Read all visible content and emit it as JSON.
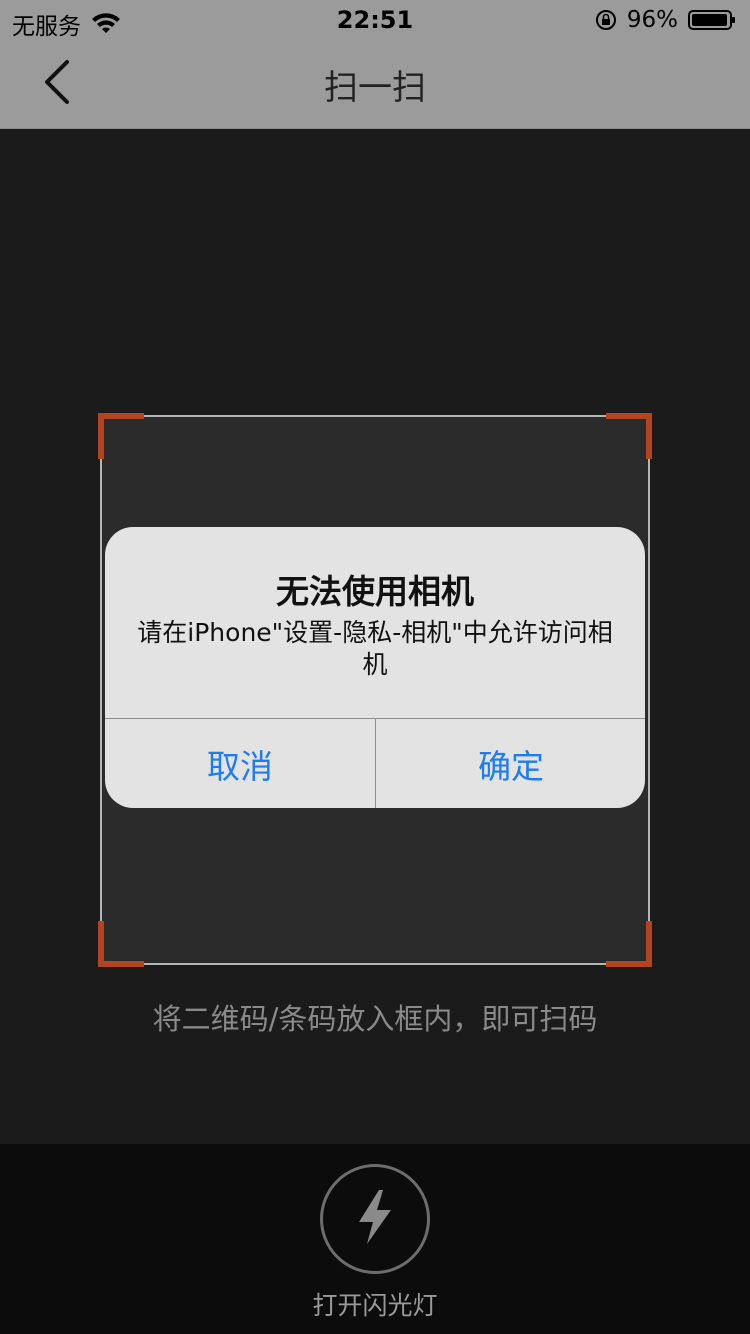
{
  "status_bar": {
    "carrier": "无服务",
    "time": "22:51",
    "battery_percent": "96%",
    "battery_level": 0.96,
    "icons": [
      "wifi-icon",
      "lock-rotation-icon",
      "battery-icon"
    ]
  },
  "nav": {
    "back_icon": "chevron-left-icon",
    "title": "扫一扫"
  },
  "scanner": {
    "hint": "将二维码/条码放入框内，即可扫码",
    "corner_color": "#b2441f"
  },
  "alert": {
    "title": "无法使用相机",
    "message": "请在iPhone\"设置-隐私-相机\"中允许访问相机",
    "cancel_label": "取消",
    "confirm_label": "确定",
    "button_color": "#1e7cf2"
  },
  "bottom": {
    "flash_icon": "lightning-icon",
    "flash_label": "打开闪光灯"
  }
}
